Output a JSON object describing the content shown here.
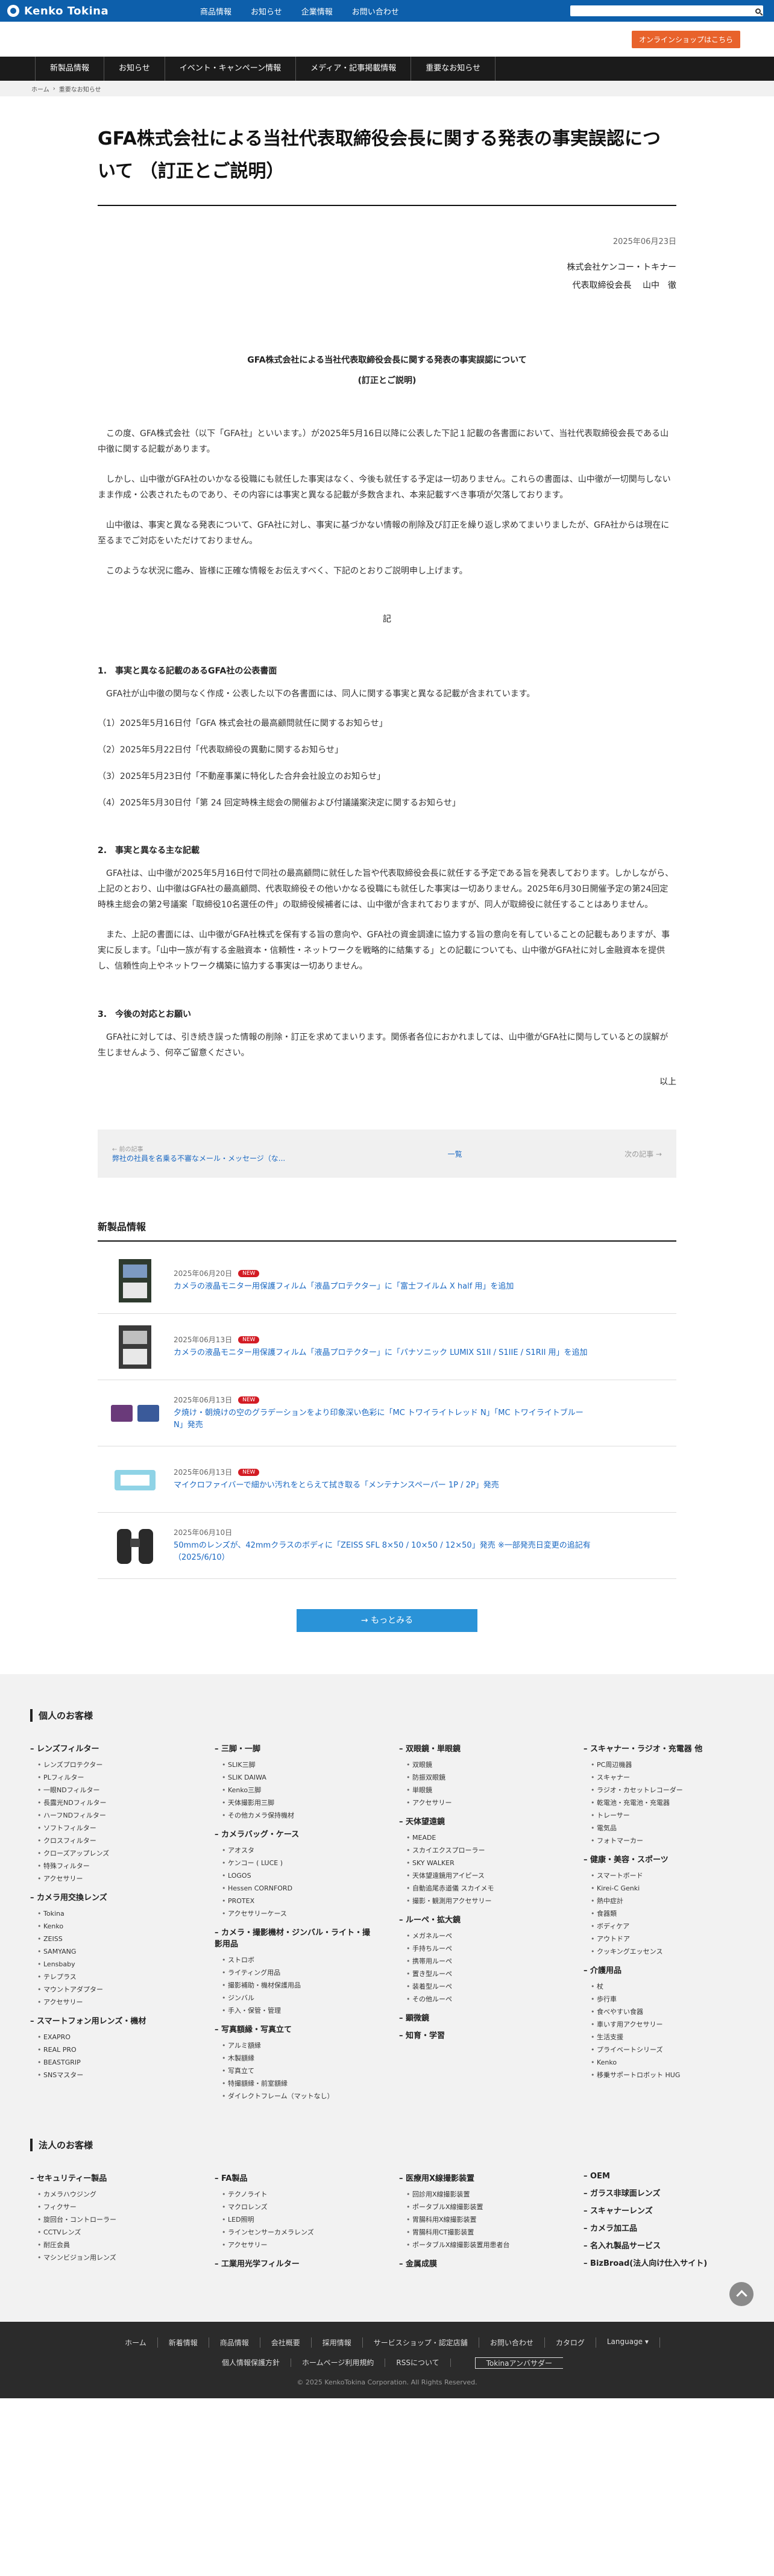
{
  "header": {
    "logo": "Kenko Tokina",
    "nav": [
      "商品情報",
      "お知らせ",
      "企業情報",
      "お問い合わせ"
    ],
    "shop_button": "オンラインショップはこちら"
  },
  "catnav": [
    "新製品情報",
    "お知らせ",
    "イベント・キャンペーン情報",
    "メディア・記事掲載情報",
    "重要なお知らせ"
  ],
  "breadcrumb": [
    "ホーム",
    "重要なお知らせ"
  ],
  "article": {
    "title": "GFA株式会社による当社代表取締役会長に関する発表の事実誤認について （訂正とご説明）",
    "date": "2025年06月23日",
    "company": "株式会社ケンコー・トキナー",
    "signer": "代表取締役会長　 山中　徹",
    "doc_title_1": "GFA株式会社による当社代表取締役会長に関する発表の事実誤認について",
    "doc_title_2": "(訂正とご説明)",
    "p1": "この度、GFA株式会社（以下「GFA社」といいます。）が2025年5月16日以降に公表した下記１記載の各書面において、当社代表取締役会長である山中徹に関する記載があります。",
    "p2": "しかし、山中徹がGFA社のいかなる役職にも就任した事実はなく、今後も就任する予定は一切ありません。これらの書面は、山中徹が一切関与しないまま作成・公表されたものであり、その内容には事実と異なる記載が多数含まれ、本来記載すべき事項が欠落しております。",
    "p3": "山中徹は、事実と異なる発表について、GFA社に対し、事実に基づかない情報の削除及び訂正を繰り返し求めてまいりましたが、GFA社からは現在に至るまでご対応をいただけておりません。",
    "p4": "このような状況に鑑み、皆様に正確な情報をお伝えすべく、下記のとおりご説明申し上げます。",
    "ki": "記",
    "s1_head": "1.　事実と異なる記載のあるGFA社の公表書面",
    "s1_intro": "GFA社が山中徹の関与なく作成・公表した以下の各書面には、同人に関する事実と異なる記載が含まれています。",
    "s1_items": [
      "（1）2025年5月16日付「GFA 株式会社の最高顧問就任に関するお知らせ」",
      "（2）2025年5月22日付「代表取締役の異動に関するお知らせ」",
      "（3）2025年5月23日付「不動産事業に特化した合弁会社設立のお知らせ」",
      "（4）2025年5月30日付「第 24 回定時株主総会の開催および付議議案決定に関するお知らせ」"
    ],
    "s2_head": "2.　事実と異なる主な記載",
    "s2_p1": "GFA社は、山中徹が2025年5月16日付で同社の最高顧問に就任した旨や代表取締役会長に就任する予定である旨を発表しております。しかしながら、上記のとおり、山中徹はGFA社の最高顧問、代表取締役その他いかなる役職にも就任した事実は一切ありません。2025年6月30日開催予定の第24回定時株主総会の第2号議案「取締役10名選任の件」の取締役候補者には、山中徹が含まれておりますが、同人が取締役に就任することはありません。",
    "s2_p2": "また、上記の書面には、山中徹がGFA社株式を保有する旨の意向や、GFA社の資金調達に協力する旨の意向を有していることの記載もありますが、事実に反します。「山中一族が有する金融資本・信頼性・ネットワークを戦略的に結集する」との記載についても、山中徹がGFA社に対し金融資本を提供し、信頼性向上やネットワーク構築に協力する事実は一切ありません。",
    "s3_head": "3.　今後の対応とお願い",
    "s3_p": "GFA社に対しては、引き続き誤った情報の削除・訂正を求めてまいります。関係者各位におかれましては、山中徹がGFA社に関与しているとの誤解が生じませんよう、何卒ご留意ください。",
    "ijou": "以上"
  },
  "pager": {
    "prev_label": "← 前の記事",
    "prev_title": "弊社の社員を名乗る不審なメール・メッセージ（な...",
    "list": "一覧",
    "next": "次の記事 →"
  },
  "news": {
    "heading": "新製品情報",
    "badge": "NEW",
    "items": [
      {
        "date": "2025年06月20日",
        "title": "カメラの液晶モニター用保護フィルム「液晶プロテクター」に「富士フイルム X half 用」を追加",
        "new": true
      },
      {
        "date": "2025年06月13日",
        "title": "カメラの液晶モニター用保護フィルム「液晶プロテクター」に「パナソニック LUMIX S1II / S1IIE / S1RII 用」を追加",
        "new": true
      },
      {
        "date": "2025年06月13日",
        "title": "夕焼け・朝焼けの空のグラデーションをより印象深い色彩に「MC トワイライトレッド N」「MC トワイライトブルー N」発売",
        "new": true
      },
      {
        "date": "2025年06月13日",
        "title": "マイクロファイバーで細かい汚れをとらえて拭き取る「メンテナンスペーパー 1P / 2P」発売",
        "new": true
      },
      {
        "date": "2025年06月10日",
        "title": "50mmのレンズが、42mmクラスのボディに「ZEISS SFL 8×50 / 10×50 / 12×50」発売 ※一部発売日変更の追記有（2025/6/10）",
        "new": false
      }
    ],
    "more": "→ もっとみる"
  },
  "footer": {
    "personal": "個人のお客様",
    "personal_cols": [
      [
        {
          "cat": "レンズフィルター",
          "subs": [
            "レンズプロテクター",
            "PLフィルター",
            "一眼NDフィルター",
            "長露光NDフィルター",
            "ハーフNDフィルター",
            "ソフトフィルター",
            "クロスフィルター",
            "クローズアップレンズ",
            "特殊フィルター",
            "アクセサリー"
          ]
        },
        {
          "cat": "カメラ用交換レンズ",
          "subs": [
            "Tokina",
            "Kenko",
            "ZEISS",
            "SAMYANG",
            "Lensbaby",
            "テレプラス",
            "マウントアダプター",
            "アクセサリー"
          ]
        },
        {
          "cat": "スマートフォン用レンズ・機材",
          "subs": [
            "EXAPRO",
            "REAL PRO",
            "BEASTGRIP",
            "SNSマスター"
          ]
        }
      ],
      [
        {
          "cat": "三脚・一脚",
          "subs": [
            "SLIK三脚",
            "SLIK DAIWA",
            "Kenko三脚",
            "天体撮影用三脚",
            "その他カメラ保持機材"
          ]
        },
        {
          "cat": "カメラバッグ・ケース",
          "subs": [
            "アオスタ",
            "ケンコー ( LUCE )",
            "LOGOS",
            "Hessen CORNFORD",
            "PROTEX",
            "アクセサリーケース"
          ]
        },
        {
          "cat": "カメラ・撮影機材・ジンバル・ライト・撮影用品",
          "subs": [
            "ストロボ",
            "ライティング用品",
            "撮影補助・機材保護用品",
            "ジンバル",
            "手入・保管・管理"
          ]
        },
        {
          "cat": "写真額縁・写真立て",
          "subs": [
            "アルミ額縁",
            "木製額縁",
            "写真立て",
            "特撮額縁・前室額縁",
            "ダイレクトフレーム（マットなし）"
          ]
        }
      ],
      [
        {
          "cat": "双眼鏡・単眼鏡",
          "subs": [
            "双眼鏡",
            "防振双眼鏡",
            "単眼鏡",
            "アクセサリー"
          ]
        },
        {
          "cat": "天体望遠鏡",
          "subs": [
            "MEADE",
            "スカイエクスプローラー",
            "SKY WALKER",
            "天体望遠鏡用アイピース",
            "自動追尾赤道儀 スカイメモ",
            "撮影・観測用アクセサリー"
          ]
        },
        {
          "cat": "ルーペ・拡大鏡",
          "subs": [
            "メガネルーペ",
            "手持ちルーペ",
            "携帯用ルーペ",
            "置き型ルーペ",
            "装着型ルーペ",
            "その他ルーペ"
          ]
        },
        {
          "cat": "顕微鏡",
          "subs": []
        },
        {
          "cat": "知育・学習",
          "subs": []
        }
      ],
      [
        {
          "cat": "スキャナー・ラジオ・充電器 他",
          "subs": [
            "PC周辺機器",
            "スキャナー",
            "ラジオ・カセットレコーダー",
            "乾電池・充電池・充電器",
            "トレーサー",
            "電気品",
            "フォトマーカー"
          ]
        },
        {
          "cat": "健康・美容・スポーツ",
          "subs": [
            "スマートボード",
            "Kirei-C Genki",
            "熱中症計",
            "食器類",
            "ボディケア",
            "アウトドア",
            "クッキングエッセンス"
          ]
        },
        {
          "cat": "介護用品",
          "subs": [
            "杖",
            "歩行車",
            "食べやすい食器",
            "車いす用アクセサリー",
            "生活支援",
            "プライベートシリーズ",
            "Kenko",
            "移乗サポートロボット HUG"
          ]
        }
      ]
    ],
    "corporate": "法人のお客様",
    "corporate_cols": [
      [
        {
          "cat": "セキュリティー製品",
          "subs": [
            "カメラハウジング",
            "フィクサー",
            "旋回台・コントローラー",
            "CCTVレンズ",
            "耐圧会員",
            "マシンビジョン用レンズ"
          ]
        }
      ],
      [
        {
          "cat": "FA製品",
          "subs": [
            "テクノライト",
            "マクロレンズ",
            "LED照明",
            "ラインセンサーカメラレンズ",
            "アクセサリー"
          ]
        },
        {
          "cat": "工業用光学フィルター",
          "subs": []
        }
      ],
      [
        {
          "cat": "医療用X線撮影装置",
          "subs": [
            "回診用X線撮影装置",
            "ポータブルX線撮影装置",
            "胃腸科用X線撮影装置",
            "胃腸科用CT撮影装置",
            "ポータブルX線撮影装置用患者台"
          ]
        },
        {
          "cat": "金属成膜",
          "subs": []
        }
      ],
      [
        {
          "cat": "OEM",
          "subs": []
        },
        {
          "cat": "ガラス非球面レンズ",
          "subs": []
        },
        {
          "cat": "スキャナーレンズ",
          "subs": []
        },
        {
          "cat": "カメラ加工品",
          "subs": []
        },
        {
          "cat": "名入れ製品サービス",
          "subs": []
        },
        {
          "cat": "BizBroad(法人向け仕入サイト)",
          "subs": []
        }
      ]
    ],
    "links1": [
      "ホーム",
      "新着情報",
      "商品情報",
      "会社概要",
      "採用情報",
      "サービスショップ・認定店舗",
      "お問い合わせ",
      "カタログ",
      "Language ▾"
    ],
    "links2": [
      "個人情報保護方針",
      "ホームページ利用規約",
      "RSSについて"
    ],
    "tokina_button": "Tokinaアンバサダー",
    "copyright": "© 2025 KenkoTokina Corporation. All Rights Reserved."
  }
}
